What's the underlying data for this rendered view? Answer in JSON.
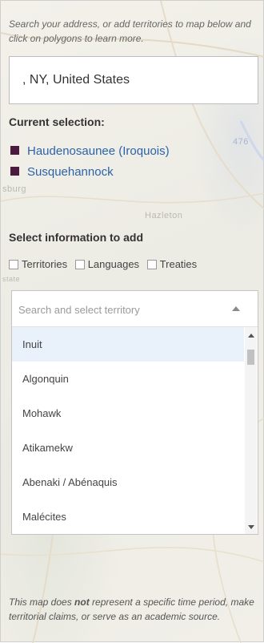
{
  "intro_text": "Search your address, or add territories to map below and click on polygons to learn more.",
  "address_value": ", NY, United States",
  "current_selection": {
    "title": "Current selection:",
    "items": [
      {
        "label": "Haudenosaunee (Iroquois)",
        "color": "#4a1b3f"
      },
      {
        "label": "Susquehannock",
        "color": "#4a1b3f"
      }
    ]
  },
  "add_info": {
    "title": "Select information to add",
    "checkboxes": [
      "Territories",
      "Languages",
      "Treaties"
    ]
  },
  "territory_select": {
    "placeholder": "Search and select territory",
    "options": [
      "Inuit",
      "Algonquin",
      "Mohawk",
      "Atikamekw",
      "Abenaki / Abénaquis",
      "Malécites"
    ]
  },
  "disclaimer": {
    "part1": "This map does ",
    "emphasis": "not",
    "part2": " represent a specific time period, make territorial claims, or serve as an academic source."
  },
  "map_labels": [
    "Hazleton",
    "sburg",
    "476",
    "state"
  ]
}
